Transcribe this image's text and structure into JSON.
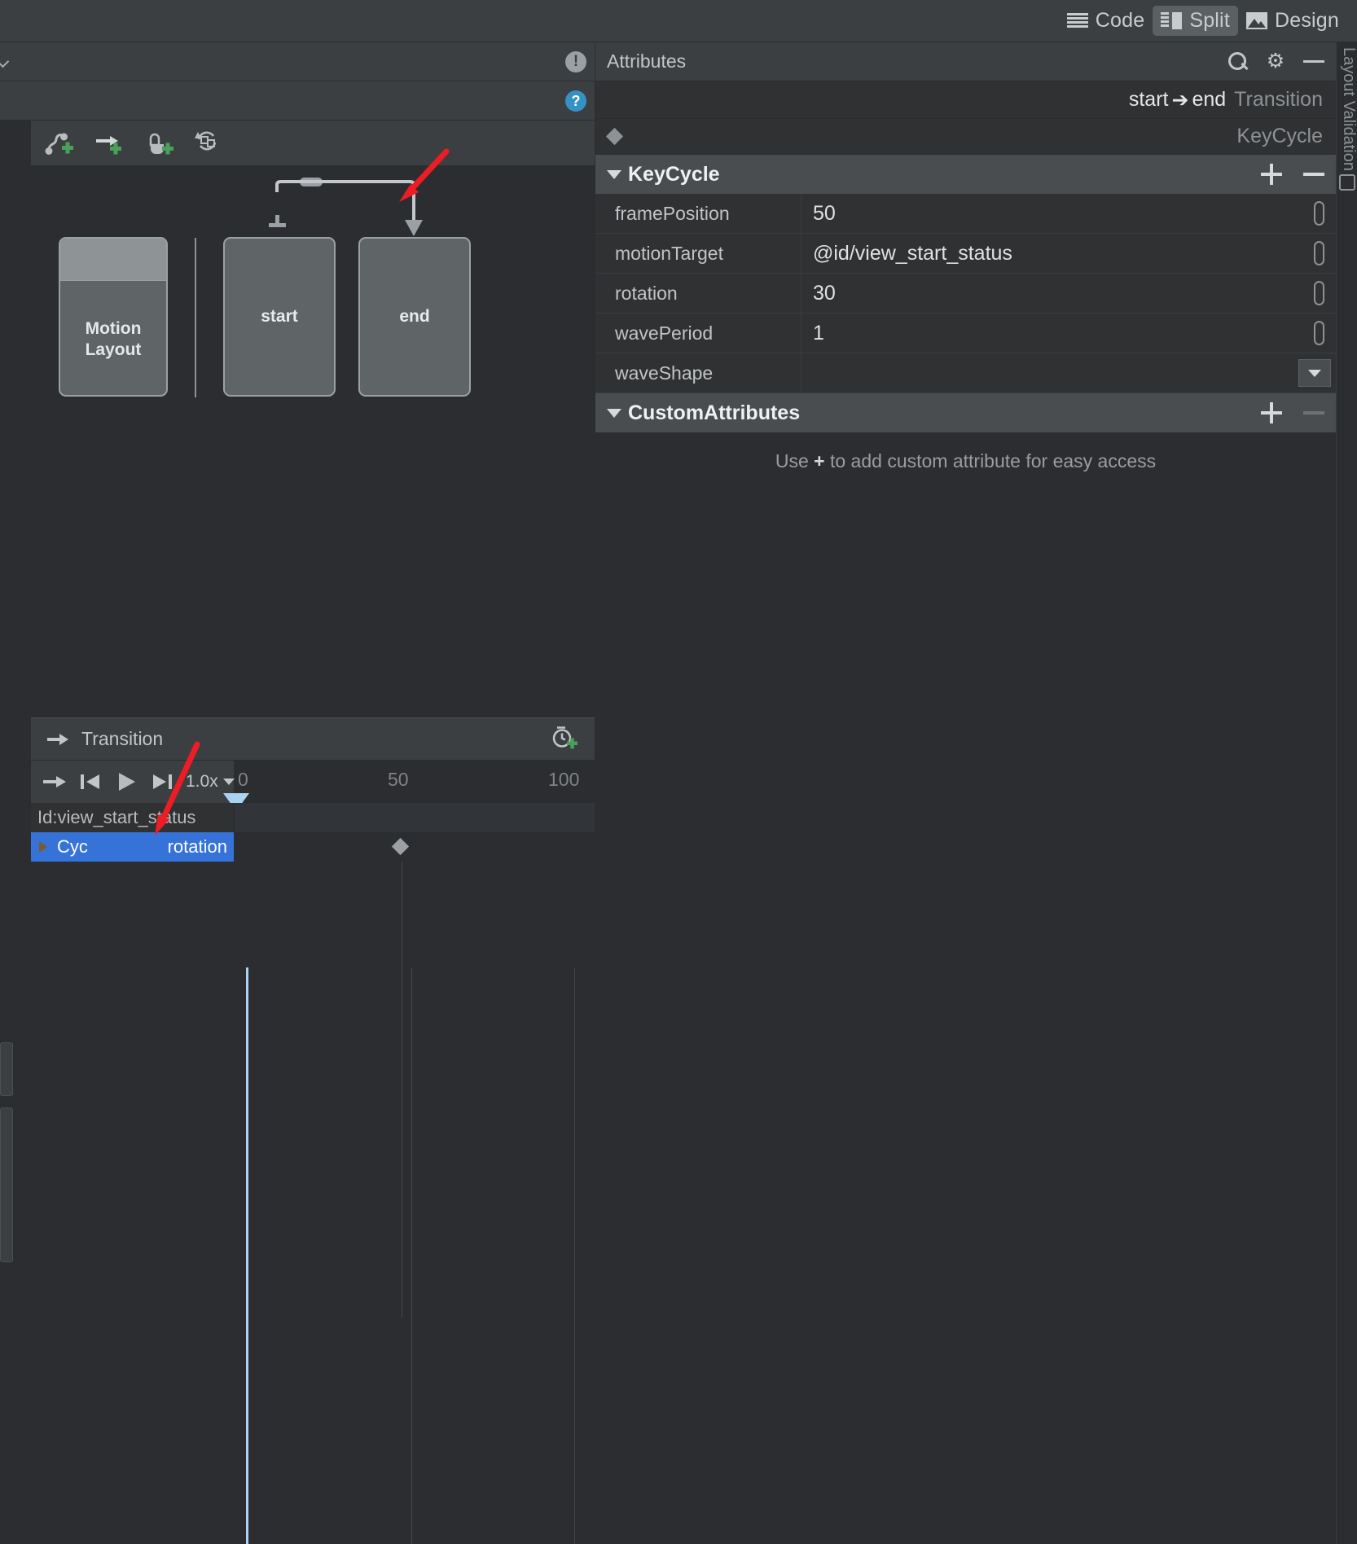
{
  "editor_modes": [
    {
      "label": "Code",
      "icon": "code-lines-icon",
      "active": false
    },
    {
      "label": "Split",
      "icon": "split-view-icon",
      "active": true
    },
    {
      "label": "Design",
      "icon": "design-image-icon",
      "active": false
    }
  ],
  "design": {
    "toolbar": {
      "create_constraint_set": "create-constraint-set-icon",
      "create_transition": "create-transition-icon",
      "create_on_click": "create-on-click-icon",
      "refresh": "refresh-icon"
    },
    "overview_icons": {
      "warning": "warning-icon",
      "help": "help-icon",
      "chevron": "chevron-down-icon"
    },
    "motion_layout_label_line1": "Motion",
    "motion_layout_label_line2": "Layout",
    "states": [
      {
        "name": "start"
      },
      {
        "name": "end"
      }
    ]
  },
  "timeline": {
    "panel_title": "Transition",
    "panel_icon": "transition-arrow-icon",
    "add_keyframe_icon": "add-keyframe-clock-icon",
    "controls": {
      "loop": "loop-forward-icon",
      "start": "skip-to-start-icon",
      "play": "play-icon",
      "end": "skip-to-end-icon",
      "speed": "1.0x"
    },
    "ruler_ticks": [
      "0",
      "50",
      "100"
    ],
    "rows": [
      {
        "type": "object",
        "label": "Id:view_start_status",
        "selected": false
      },
      {
        "type": "key",
        "key_label": "Cyc",
        "attr_label": "rotation",
        "selected": true,
        "keyframe_at": 50
      }
    ],
    "playhead_position": 0
  },
  "attributes": {
    "panel_title": "Attributes",
    "tools": {
      "search": "search-icon",
      "settings": "gear-icon",
      "minimize": "minimize-icon"
    },
    "selection_from": "start",
    "selection_to": "end",
    "selection_suffix": "Transition",
    "selection_type": "KeyCycle",
    "sections": [
      {
        "name": "KeyCycle",
        "add_label": "+",
        "remove_label": "−",
        "rows": [
          {
            "key": "framePosition",
            "value": "50",
            "control": "pill"
          },
          {
            "key": "motionTarget",
            "value": "@id/view_start_status",
            "control": "pill"
          },
          {
            "key": "rotation",
            "value": "30",
            "control": "pill"
          },
          {
            "key": "wavePeriod",
            "value": "1",
            "control": "pill"
          },
          {
            "key": "waveShape",
            "value": "",
            "control": "dropdown"
          }
        ]
      },
      {
        "name": "CustomAttributes",
        "add_label": "+",
        "remove_label": "−",
        "hint_prefix": "Use ",
        "hint_plus": "+",
        "hint_suffix": " to add custom attribute for easy access"
      }
    ]
  },
  "edge_strip": {
    "vertical_label": "Layout Validation"
  },
  "colors": {
    "accent_blue": "#3573d8",
    "playhead": "#a9d3f0",
    "panel_bg": "#2f3133",
    "chrome_bg": "#3c3f41",
    "canvas_bg": "#2b2d30",
    "annotation_red": "#ee1c24"
  }
}
